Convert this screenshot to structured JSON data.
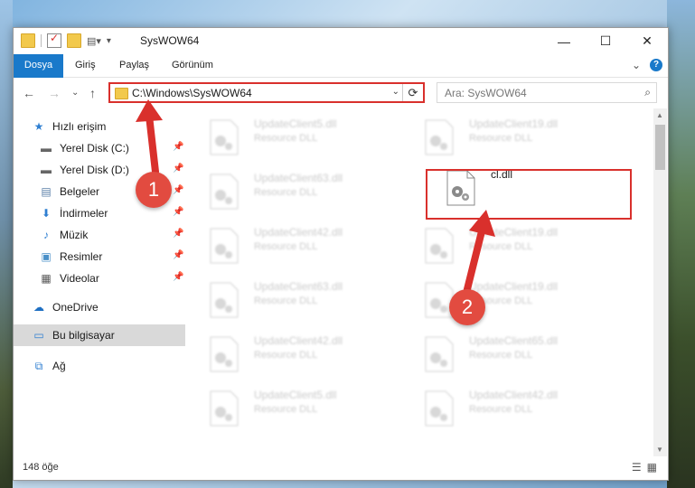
{
  "window": {
    "title": "SysWOW64"
  },
  "window_buttons": {
    "minimize": "—",
    "maximize": "☐",
    "close": "✕"
  },
  "ribbon": {
    "tabs": [
      "Dosya",
      "Giriş",
      "Paylaş",
      "Görünüm"
    ],
    "expand": "⌄",
    "help": "?"
  },
  "nav": {
    "back": "←",
    "forward": "→",
    "recent": "⌄",
    "up": "↑"
  },
  "address": {
    "path": "C:\\Windows\\SysWOW64",
    "drop": "⌄",
    "refresh": "⟳"
  },
  "search": {
    "placeholder": "Ara: SysWOW64",
    "icon": "⌕"
  },
  "sidebar": {
    "items": [
      {
        "label": "Hızlı erişim",
        "icon": "star-icon",
        "glyph": "★"
      },
      {
        "label": "Yerel Disk (C:)",
        "icon": "drive-icon",
        "glyph": "▬",
        "pin": "📌"
      },
      {
        "label": "Yerel Disk (D:)",
        "icon": "drive-icon",
        "glyph": "▬",
        "pin": "📌"
      },
      {
        "label": "Belgeler",
        "icon": "documents-icon",
        "glyph": "▤",
        "pin": "📌"
      },
      {
        "label": "İndirmeler",
        "icon": "downloads-icon",
        "glyph": "⬇",
        "pin": "📌"
      },
      {
        "label": "Müzik",
        "icon": "music-icon",
        "glyph": "♪",
        "pin": "📌"
      },
      {
        "label": "Resimler",
        "icon": "pictures-icon",
        "glyph": "▣",
        "pin": "📌"
      },
      {
        "label": "Videolar",
        "icon": "videos-icon",
        "glyph": "▦",
        "pin": "📌"
      },
      {
        "label": "OneDrive",
        "icon": "onedrive-icon",
        "glyph": "☁"
      },
      {
        "label": "Bu bilgisayar",
        "icon": "computer-icon",
        "glyph": "▭"
      },
      {
        "label": "Ağ",
        "icon": "network-icon",
        "glyph": "⧉"
      }
    ]
  },
  "files": [
    {
      "name": "UpdateClient5.dll",
      "type": "Resource DLL"
    },
    {
      "name": "UpdateClient19.dll",
      "type": "Resource DLL"
    },
    {
      "name": "UpdateClient63.dll",
      "type": "Resource DLL"
    },
    {
      "name": "cl.dll",
      "type": ""
    },
    {
      "name": "UpdateClient42.dll",
      "type": "Resource DLL"
    },
    {
      "name": "UpdateClient19.dll",
      "type": "Resource DLL"
    },
    {
      "name": "UpdateClient63.dll",
      "type": "Resource DLL"
    },
    {
      "name": "UpdateClient19.dll",
      "type": "Resource DLL"
    },
    {
      "name": "UpdateClient42.dll",
      "type": "Resource DLL"
    },
    {
      "name": "UpdateClient65.dll",
      "type": "Resource DLL"
    },
    {
      "name": "UpdateClient5.dll",
      "type": "Resource DLL"
    },
    {
      "name": "UpdateClient42.dll",
      "type": "Resource DLL"
    }
  ],
  "status": {
    "count": "148 öğe",
    "details_view": "☰",
    "icons_view": "▦"
  },
  "annotations": {
    "step1": "1",
    "step2": "2",
    "color": "#d9302c"
  }
}
